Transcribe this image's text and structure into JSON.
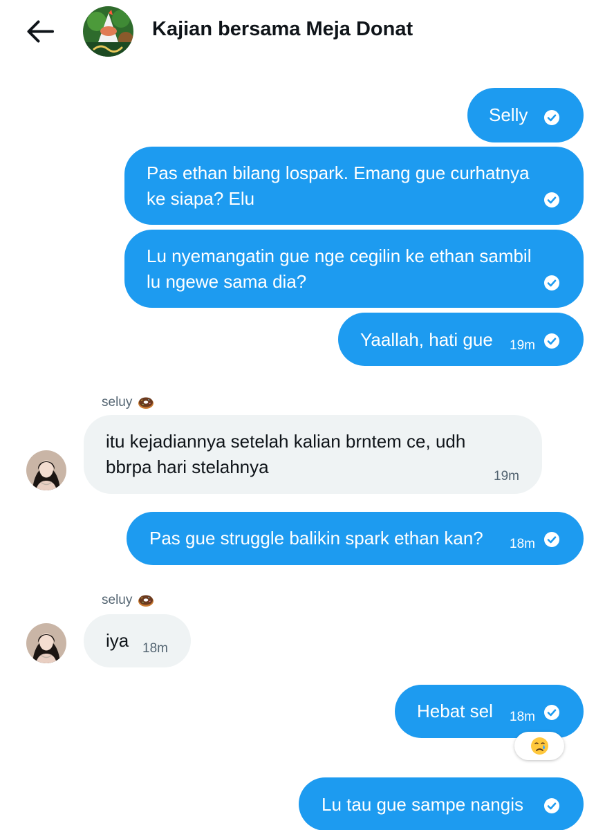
{
  "header": {
    "title": "Kajian bersama Meja Donat",
    "back_icon": "arrow-left-icon",
    "group_avatar": "group-avatar-image"
  },
  "colors": {
    "outgoing_bubble": "#1d9bf0",
    "incoming_bubble": "#eff3f4",
    "secondary_text": "#536471"
  },
  "messages": [
    {
      "direction": "out",
      "lines": [
        "Selly"
      ],
      "time": "",
      "status_icon": "check-circle-icon"
    },
    {
      "direction": "out",
      "lines": [
        "Pas ethan bilang lospark. Emang gue curhatnya",
        "ke siapa? Elu"
      ],
      "time": "",
      "status_icon": "check-circle-icon"
    },
    {
      "direction": "out",
      "lines": [
        "Lu nyemangatin gue nge cegilin ke ethan sambil",
        "lu ngewe sama dia?"
      ],
      "time": "",
      "status_icon": "check-circle-icon"
    },
    {
      "direction": "out",
      "lines": [
        "Yaallah, hati gue"
      ],
      "time": "19m",
      "status_icon": "check-circle-icon"
    },
    {
      "direction": "in",
      "sender": "seluy",
      "sender_emoji": "donut-emoji",
      "lines": [
        "itu kejadiannya setelah kalian brntem ce, udh",
        "bbrpa hari stelahnya"
      ],
      "time": "19m"
    },
    {
      "direction": "out",
      "lines": [
        "Pas gue struggle balikin spark ethan kan?"
      ],
      "time": "18m",
      "status_icon": "check-circle-icon"
    },
    {
      "direction": "in",
      "sender": "seluy",
      "sender_emoji": "donut-emoji",
      "lines": [
        "iya"
      ],
      "time": "18m"
    },
    {
      "direction": "out",
      "lines": [
        "Hebat sel"
      ],
      "time": "18m",
      "status_icon": "check-circle-icon",
      "reaction": "crying-face-emoji"
    },
    {
      "direction": "out",
      "lines": [
        "Lu tau gue sampe nangis"
      ],
      "time": "",
      "status_icon": "check-circle-icon"
    }
  ]
}
